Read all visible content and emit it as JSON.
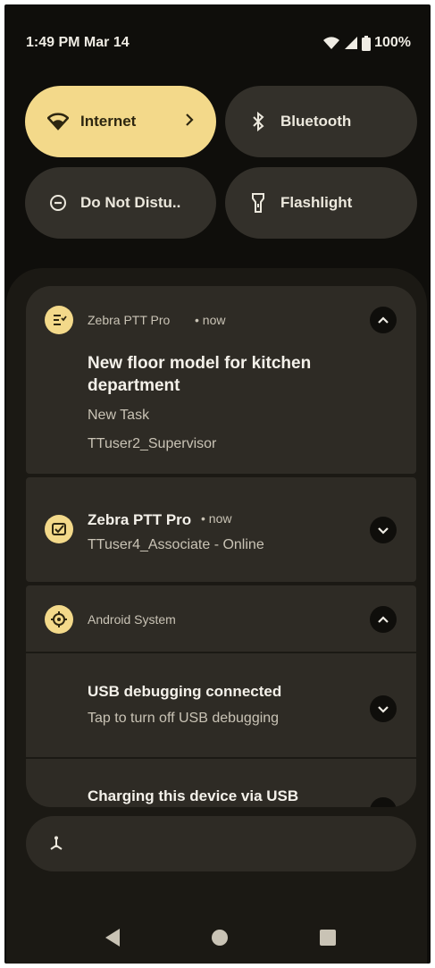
{
  "status_bar": {
    "time": "1:49 PM Mar 14",
    "battery": "100%"
  },
  "quick_settings": [
    {
      "label": "Internet",
      "icon": "wifi-icon",
      "active": true
    },
    {
      "label": "Bluetooth",
      "icon": "bluetooth-icon",
      "active": false
    },
    {
      "label": "Do Not Distu..",
      "icon": "do-not-disturb-icon",
      "active": false
    },
    {
      "label": "Flashlight",
      "icon": "flashlight-icon",
      "active": false
    }
  ],
  "notifications": [
    {
      "app": "Zebra PTT Pro",
      "time": "• now",
      "title": "New floor model for kitchen department",
      "line1": "New Task",
      "line2": "TTuser2_Supervisor",
      "expanded": true
    },
    {
      "app": "Zebra PTT Pro",
      "time": "• now",
      "line1": "TTuser4_Associate - Online",
      "expanded": false
    },
    {
      "app": "Android System",
      "items": [
        {
          "title": "USB debugging connected",
          "body": "Tap to turn off USB debugging"
        },
        {
          "title": "Charging this device via USB",
          "body": ""
        }
      ],
      "expanded": true
    }
  ],
  "colors": {
    "accent": "#f3d98a",
    "surface": "#2e2b25",
    "background": "#0f0e0b"
  }
}
